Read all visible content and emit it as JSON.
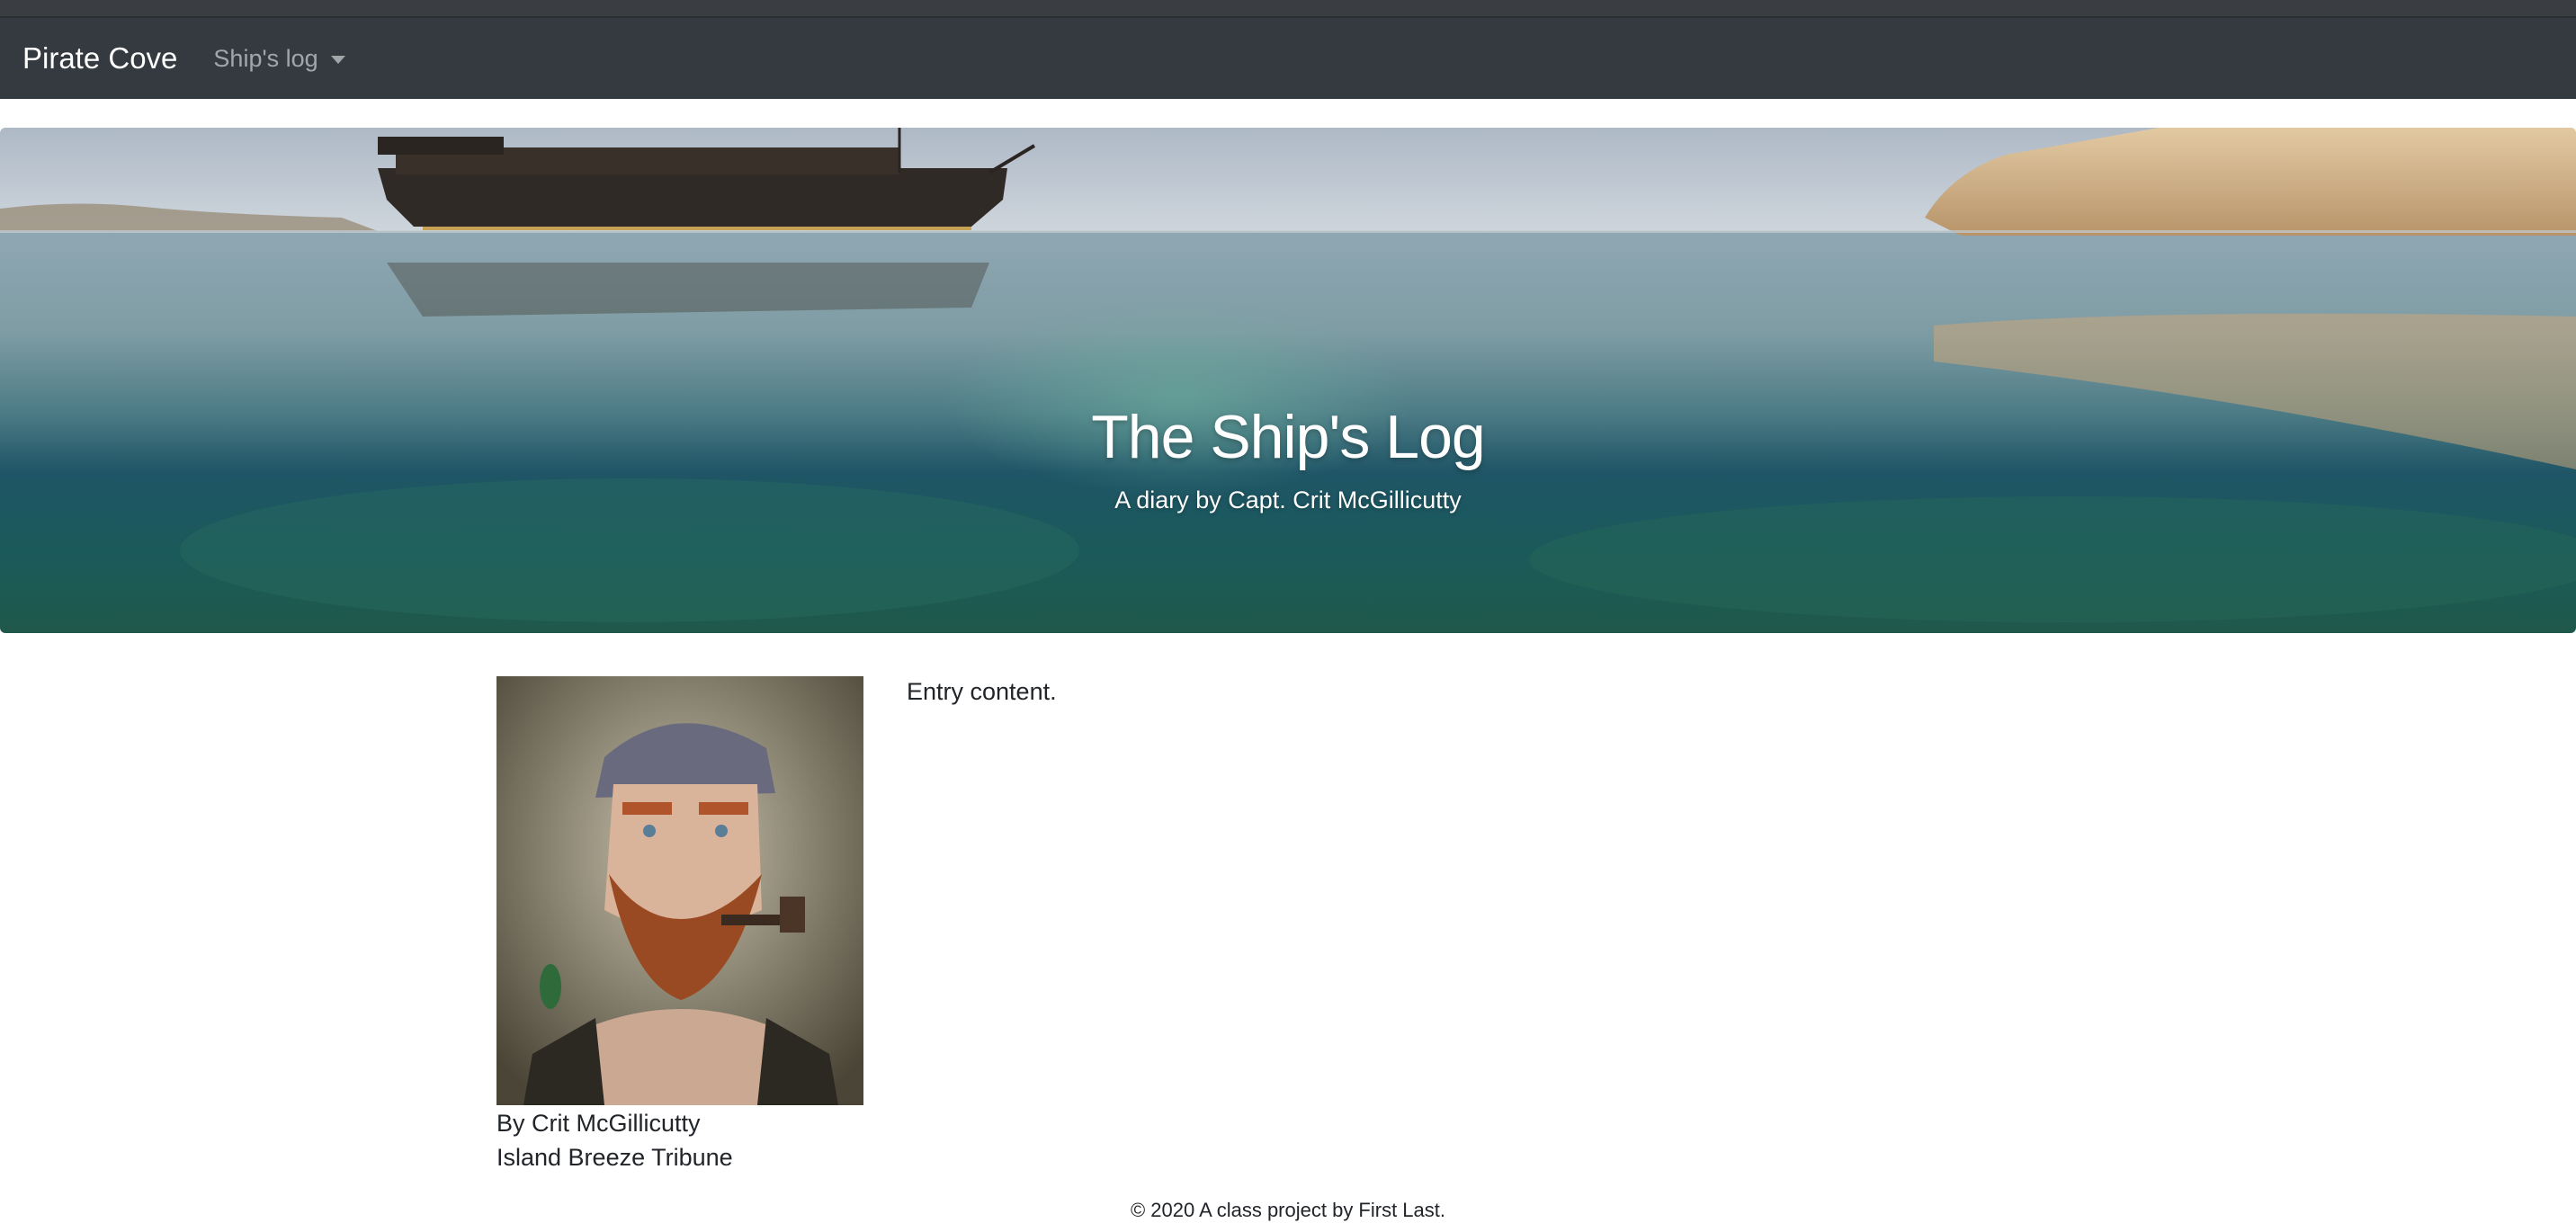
{
  "navbar": {
    "brand": "Pirate Cove",
    "dropdown_label": "Ship's log"
  },
  "hero": {
    "title": "The Ship's Log",
    "subtitle": "A diary by Capt. Crit McGillicutty"
  },
  "entry": {
    "content": "Entry content.",
    "author_line": "By Crit McGillicutty",
    "publication": "Island Breeze Tribune"
  },
  "footer": {
    "text": "© 2020 A class project by First Last."
  },
  "colors": {
    "navbar_bg": "#343a40",
    "brand_text": "#ffffff",
    "nav_link_text": "rgba(255,255,255,0.55)"
  }
}
